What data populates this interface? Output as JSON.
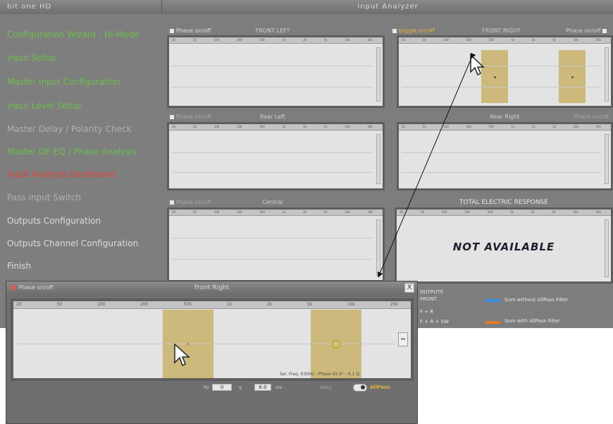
{
  "app": {
    "name": "bit one HD",
    "screen_title": "Input Analyzer"
  },
  "sidebar": {
    "items": [
      {
        "label": "Configuration Wizard - Hi-Mode"
      },
      {
        "label": "Input Setup"
      },
      {
        "label": "Master Input Configuration"
      },
      {
        "label": "Input Level Setup"
      },
      {
        "label": "Master Delay / Polarity Check"
      },
      {
        "label": "Master DE-EQ / Phase Analysis"
      },
      {
        "label": "Input Analysis Dashboard"
      },
      {
        "label": "Pass Input Switch"
      },
      {
        "label": "Outputs Configuration"
      },
      {
        "label": "Outputs Channel Configuration"
      },
      {
        "label": "Finish"
      }
    ]
  },
  "panels": {
    "front_left": {
      "title": "FRONT LEFT",
      "left_tag": "Phase on/off"
    },
    "front_right": {
      "title": "FRONT RIGHT",
      "left_tag": "toggle on/off",
      "right_tag": "Phase on/off"
    },
    "rear_left": {
      "title": "Rear Left",
      "left_tag": "Phase on/off"
    },
    "rear_right": {
      "title": "Rear Right",
      "right_tag": "Phase on/off"
    },
    "central": {
      "title": "Central",
      "left_tag": "Phase on/off"
    },
    "total": {
      "title": "TOTAL ELECTRIC RESPONSE",
      "message": "NOT AVAILABLE"
    }
  },
  "frequency_ticks": [
    "20",
    "50",
    "100",
    "200",
    "500",
    "1k",
    "2k",
    "5k",
    "10k",
    "20k"
  ],
  "legend": {
    "rows": [
      "OUTPUTS",
      "FRONT",
      "F + R",
      "F + R + SW"
    ],
    "items": [
      {
        "label": "Sum without AllPass Filter",
        "color": "#3a8fe0"
      },
      {
        "label": "Sum with AllPass Filter",
        "color": "#e07a2a"
      }
    ]
  },
  "popup": {
    "title": "Front Right",
    "phase_label": "Phase on/off",
    "close": "X",
    "hz_label": "Hz",
    "hz_value": "0",
    "q_label": "q",
    "q_value": "6.0",
    "delay_label": "delay",
    "delay_value": "0.0",
    "ms_label": "ms",
    "allpass_label": "AllPass",
    "info": "Sel. Freq. 630Hz - Phase 45.0° - 0.1 Q",
    "ticks": [
      "20",
      "50",
      "100",
      "200",
      "500",
      "1k",
      "2k",
      "5k",
      "10k",
      "20k"
    ]
  },
  "colors": {
    "menu_completed": "#6cbf4a",
    "menu_active": "#e0443a",
    "menu_disabled": "#b0b0b0",
    "band": "#c8b168"
  }
}
